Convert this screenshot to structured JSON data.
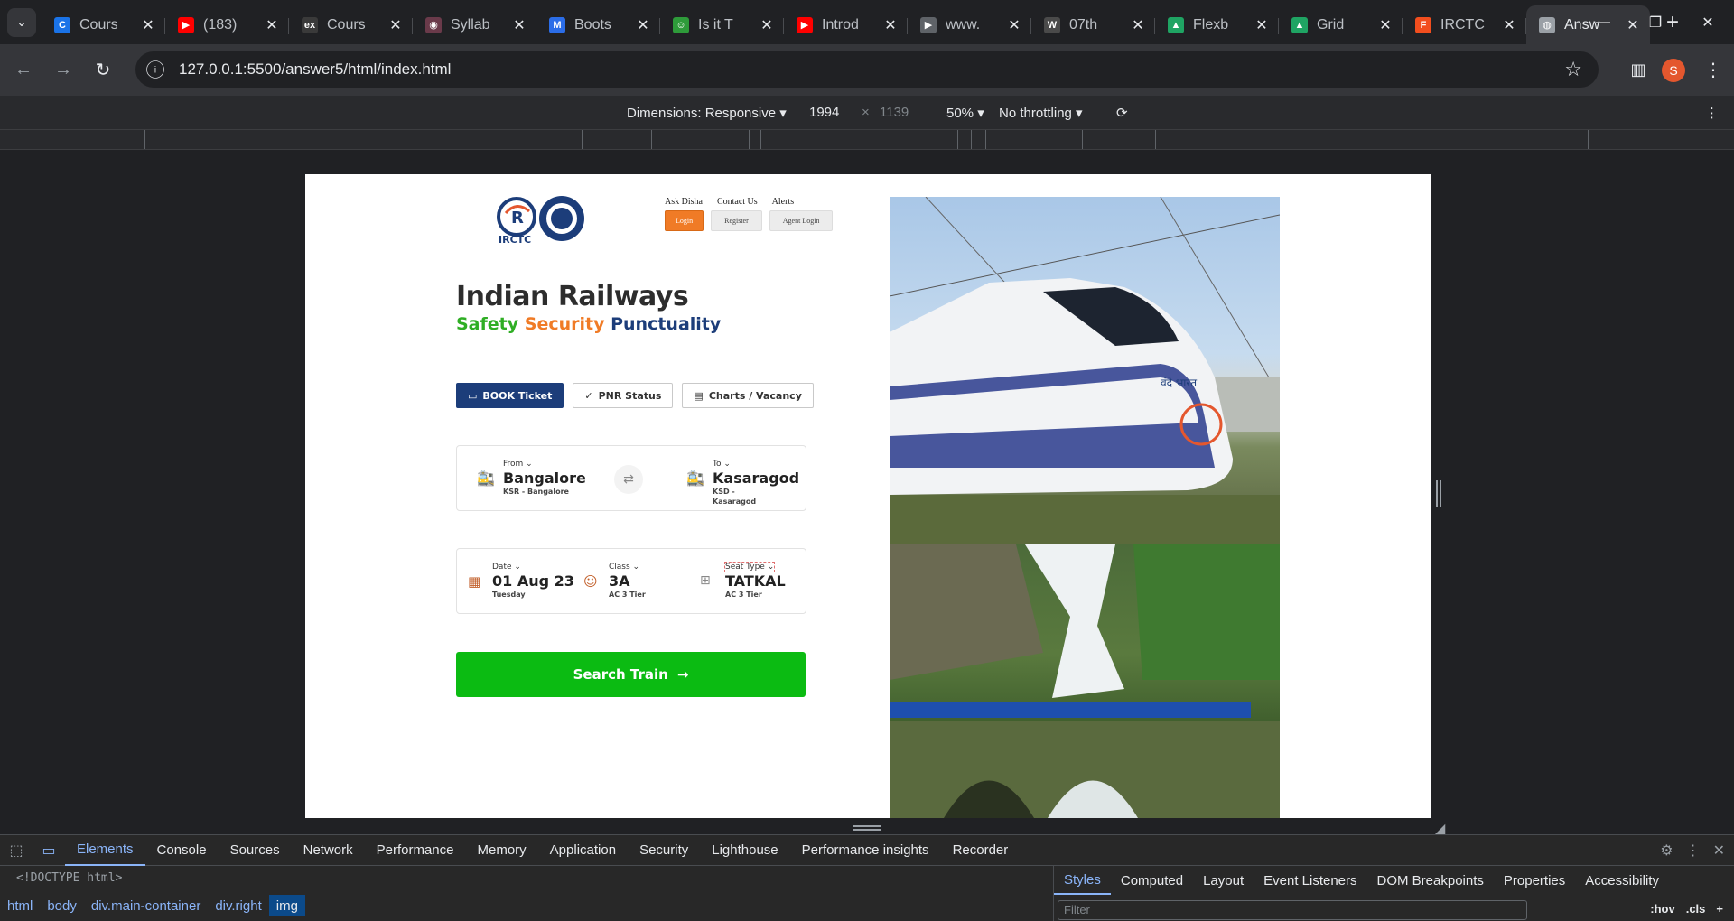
{
  "browser": {
    "tabs": [
      {
        "title": "Cours",
        "fav_color": "#1a73e8",
        "fav_glyph": "C"
      },
      {
        "title": "(183)",
        "fav_color": "#ff0000",
        "fav_glyph": "▶"
      },
      {
        "title": "Cours",
        "fav_color": "#3a3a3a",
        "fav_glyph": "ex"
      },
      {
        "title": "Syllab",
        "fav_color": "#6a3a4a",
        "fav_glyph": "◉"
      },
      {
        "title": "Boots",
        "fav_color": "#2b6de8",
        "fav_glyph": "M"
      },
      {
        "title": "Is it T",
        "fav_color": "#2e9b3a",
        "fav_glyph": "☺"
      },
      {
        "title": "Introd",
        "fav_color": "#ff0000",
        "fav_glyph": "▶"
      },
      {
        "title": "www.",
        "fav_color": "#5f6368",
        "fav_glyph": "▶"
      },
      {
        "title": "07th",
        "fav_color": "#4a4a4a",
        "fav_glyph": "W"
      },
      {
        "title": "Flexb",
        "fav_color": "#1fa463",
        "fav_glyph": "▲"
      },
      {
        "title": "Grid",
        "fav_color": "#1fa463",
        "fav_glyph": "▲"
      },
      {
        "title": "IRCTC",
        "fav_color": "#f24e1e",
        "fav_glyph": "F"
      },
      {
        "title": "Answ",
        "fav_color": "#9aa0a6",
        "fav_glyph": "◍",
        "active": true
      }
    ],
    "url": "127.0.0.1:5500/answer5/html/index.html",
    "profile_initial": "S"
  },
  "device_toolbar": {
    "dimensions": "Dimensions: Responsive",
    "width": "1994",
    "times": "×",
    "height": "1139",
    "zoom": "50%",
    "throttling": "No throttling"
  },
  "site": {
    "logo_text": "IRCTC",
    "nav_links": [
      "Ask Disha",
      "Contact Us",
      "Alerts"
    ],
    "login_label": "Login",
    "register_label": "Register",
    "agent_login_label": "Agent Login",
    "title": "Indian Railways",
    "tagline": {
      "word1": "Safety",
      "word2": "Security",
      "word3": "Punctuality"
    },
    "actions": {
      "book": "BOOK Ticket",
      "pnr": "PNR Status",
      "charts": "Charts / Vacancy"
    },
    "from": {
      "label": "From",
      "city": "Bangalore",
      "code": "KSR - Bangalore"
    },
    "to": {
      "label": "To",
      "city": "Kasaragod",
      "code_line1": "KSD -",
      "code_line2": "Kasaragod"
    },
    "date": {
      "label": "Date",
      "value": "01 Aug 23",
      "day": "Tuesday"
    },
    "class": {
      "label": "Class",
      "value": "3A",
      "detail": "AC 3 Tier"
    },
    "seat": {
      "label": "Seat Type",
      "value": "TATKAL",
      "detail": "AC 3 Tier"
    },
    "search_label": "Search Train",
    "train_sign": "वंदे भारत"
  },
  "devtools": {
    "tabs": [
      "Elements",
      "Console",
      "Sources",
      "Network",
      "Performance",
      "Memory",
      "Application",
      "Security",
      "Lighthouse",
      "Performance insights",
      "Recorder"
    ],
    "doctype": "<!DOCTYPE html>",
    "breadcrumbs": [
      "html",
      "body",
      "div.main-container",
      "div.right",
      "img"
    ],
    "styles_tabs": [
      "Styles",
      "Computed",
      "Layout",
      "Event Listeners",
      "DOM Breakpoints",
      "Properties",
      "Accessibility"
    ],
    "filter_placeholder": "Filter",
    "hov": ":hov",
    "cls": ".cls"
  },
  "colors": {
    "book_blue": "#1c3d7a",
    "search_green": "#0bbb12",
    "login_orange": "#f07b26"
  }
}
